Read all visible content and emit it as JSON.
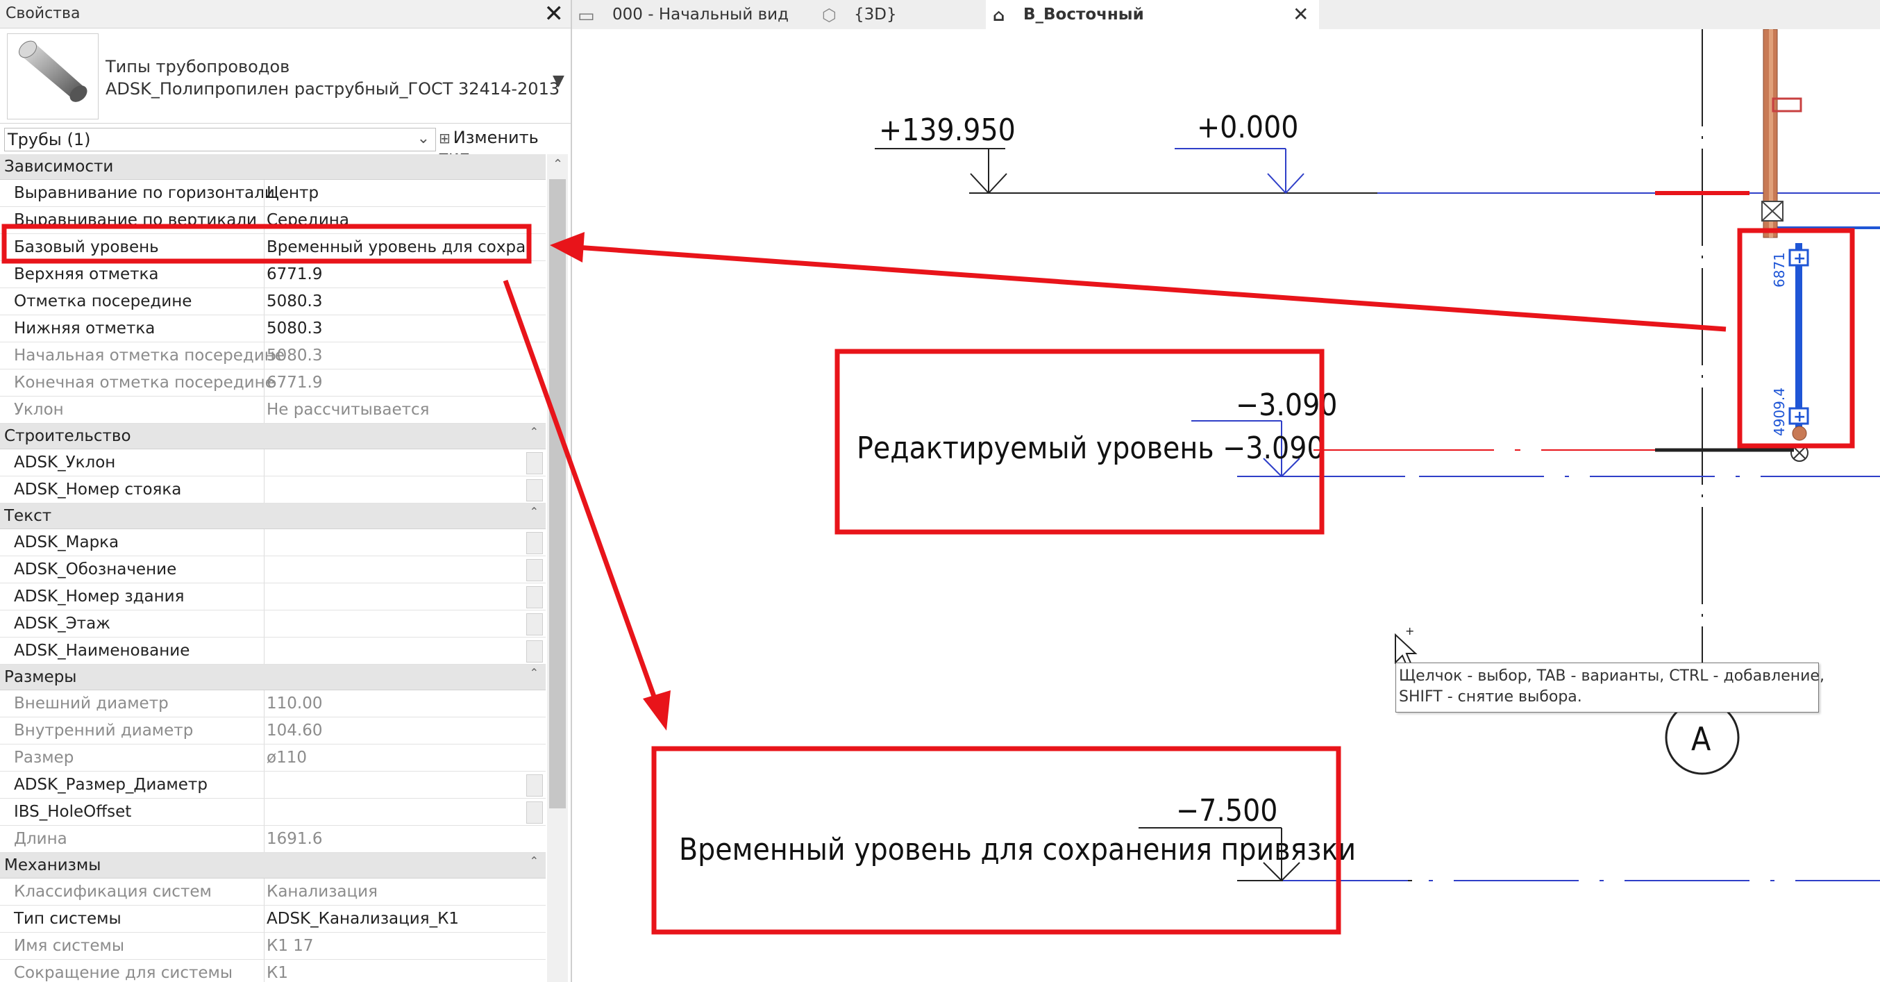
{
  "properties_panel": {
    "title": "Свойства",
    "close_glyph": "✕",
    "type_category": "Типы трубопроводов",
    "type_name": "ADSK_Полипропилен раструбный_ГОСТ 32414-2013",
    "filter_value": "Трубы (1)",
    "edit_type_label": "Изменить тип",
    "sections": [
      {
        "title": "Зависимости",
        "rows": [
          {
            "name": "Выравнивание по горизонтали",
            "value": "Центр"
          },
          {
            "name": "Выравнивание по вертикали",
            "value": "Середина"
          },
          {
            "name": "Базовый уровень",
            "value": "Временный уровень для сохра"
          },
          {
            "name": "Верхняя отметка",
            "value": "6771.9"
          },
          {
            "name": "Отметка посередине",
            "value": "5080.3"
          },
          {
            "name": "Нижняя отметка",
            "value": "5080.3"
          },
          {
            "name": "Начальная отметка посередине",
            "value": "5080.3"
          },
          {
            "name": "Конечная отметка посередине",
            "value": "6771.9"
          },
          {
            "name": "Уклон",
            "value": "Не рассчитывается"
          }
        ]
      },
      {
        "title": "Строительство",
        "rows": [
          {
            "name": "ADSK_Уклон",
            "value": ""
          },
          {
            "name": "ADSK_Номер стояка",
            "value": ""
          }
        ]
      },
      {
        "title": "Текст",
        "rows": [
          {
            "name": "ADSK_Марка",
            "value": ""
          },
          {
            "name": "ADSK_Обозначение",
            "value": ""
          },
          {
            "name": "ADSK_Номер здания",
            "value": ""
          },
          {
            "name": "ADSK_Этаж",
            "value": ""
          },
          {
            "name": "ADSK_Наименование",
            "value": ""
          }
        ]
      },
      {
        "title": "Размеры",
        "rows": [
          {
            "name": "Внешний диаметр",
            "value": "110.00"
          },
          {
            "name": "Внутренний диаметр",
            "value": "104.60"
          },
          {
            "name": "Размер",
            "value": "ø110"
          },
          {
            "name": "ADSK_Размер_Диаметр",
            "value": ""
          },
          {
            "name": "IBS_HoleOffset",
            "value": ""
          },
          {
            "name": "Длина",
            "value": "1691.6"
          }
        ]
      },
      {
        "title": "Механизмы",
        "rows": [
          {
            "name": "Классификация систем",
            "value": "Канализация"
          },
          {
            "name": "Тип системы",
            "value": "ADSK_Канализация_К1"
          },
          {
            "name": "Имя системы",
            "value": "К1 17"
          },
          {
            "name": "Сокращение для системы",
            "value": "К1"
          }
        ]
      }
    ]
  },
  "tabs": [
    {
      "label": "000 - Начальный вид"
    },
    {
      "label": "{3D}"
    },
    {
      "label": "В_Восточный"
    }
  ],
  "drawing": {
    "level_marks": {
      "top_left": "+139.950",
      "top_right": "+0.000",
      "edited_value_top": "−3.090",
      "edited_label": "Редактируемый уровень −3.090",
      "temp_value": "−7.500",
      "temp_label": "Временный уровень для сохранения привязки"
    },
    "pipe_dims": {
      "upper": "6871",
      "lower": "4909.4"
    },
    "grid_bubble": "A",
    "tooltip_line1": "Щелчок - выбор, TAB - варианты, CTRL - добавление,",
    "tooltip_line2": "SHIFT - снятие выбора."
  },
  "colors": {
    "highlight_red": "#e8141a",
    "level_blue": "#2f3fc8",
    "pipe_blue": "#1f56d6",
    "pipe_red": "#c84040"
  }
}
